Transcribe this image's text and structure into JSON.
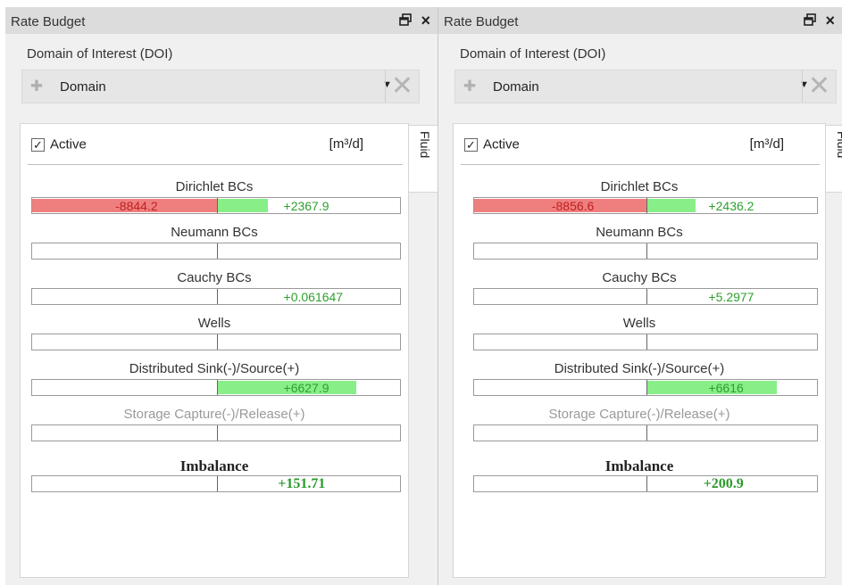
{
  "panels": [
    {
      "title": "Rate Budget",
      "float_icon": "restore-window-icon",
      "close_label": "×",
      "doi_label": "Domain of Interest (DOI)",
      "domain_value": "Domain",
      "domain_icon": "add-icon",
      "clear_icon": "close-icon",
      "active_label": "Active",
      "active_checked": true,
      "unit": "[m³/d]",
      "fluid_tab": "Fluid",
      "rows": [
        {
          "label": "Dirichlet BCs",
          "neg": "-8844.2",
          "pos": "+2367.9",
          "neg_fraction": 1.0,
          "pos_fraction": 0.27
        },
        {
          "label": "Neumann BCs",
          "neg": "",
          "pos": "",
          "neg_fraction": 0,
          "pos_fraction": 0
        },
        {
          "label": "Cauchy BCs",
          "neg": "",
          "pos": "+0.061647",
          "neg_fraction": 0,
          "pos_fraction": 0
        },
        {
          "label": "Wells",
          "neg": "",
          "pos": "",
          "neg_fraction": 0,
          "pos_fraction": 0
        },
        {
          "label": "Distributed Sink(-)/Source(+)",
          "neg": "",
          "pos": "+6627.9",
          "neg_fraction": 0,
          "pos_fraction": 0.75
        },
        {
          "label": "Storage Capture(-)/Release(+)",
          "neg": "",
          "pos": "",
          "neg_fraction": 0,
          "pos_fraction": 0
        }
      ],
      "imbalance": {
        "label": "Imbalance",
        "value": "+151.71"
      }
    },
    {
      "title": "Rate Budget",
      "float_icon": "restore-window-icon",
      "close_label": "×",
      "doi_label": "Domain of Interest (DOI)",
      "domain_value": "Domain",
      "domain_icon": "add-icon",
      "clear_icon": "close-icon",
      "active_label": "Active",
      "active_checked": true,
      "unit": "[m³/d]",
      "fluid_tab": "Fluid",
      "rows": [
        {
          "label": "Dirichlet BCs",
          "neg": "-8856.6",
          "pos": "+2436.2",
          "neg_fraction": 1.0,
          "pos_fraction": 0.28
        },
        {
          "label": "Neumann BCs",
          "neg": "",
          "pos": "",
          "neg_fraction": 0,
          "pos_fraction": 0
        },
        {
          "label": "Cauchy BCs",
          "neg": "",
          "pos": "+5.2977",
          "neg_fraction": 0,
          "pos_fraction": 0
        },
        {
          "label": "Wells",
          "neg": "",
          "pos": "",
          "neg_fraction": 0,
          "pos_fraction": 0
        },
        {
          "label": "Distributed Sink(-)/Source(+)",
          "neg": "",
          "pos": "+6616",
          "neg_fraction": 0,
          "pos_fraction": 0.75
        },
        {
          "label": "Storage Capture(-)/Release(+)",
          "neg": "",
          "pos": "",
          "neg_fraction": 0,
          "pos_fraction": 0
        }
      ],
      "imbalance": {
        "label": "Imbalance",
        "value": "+200.9"
      }
    }
  ],
  "colors": {
    "negative_fill": "#ef7f7f",
    "positive_fill": "#88ee88",
    "negative_text": "#c02020",
    "positive_text": "#2ea02e"
  }
}
